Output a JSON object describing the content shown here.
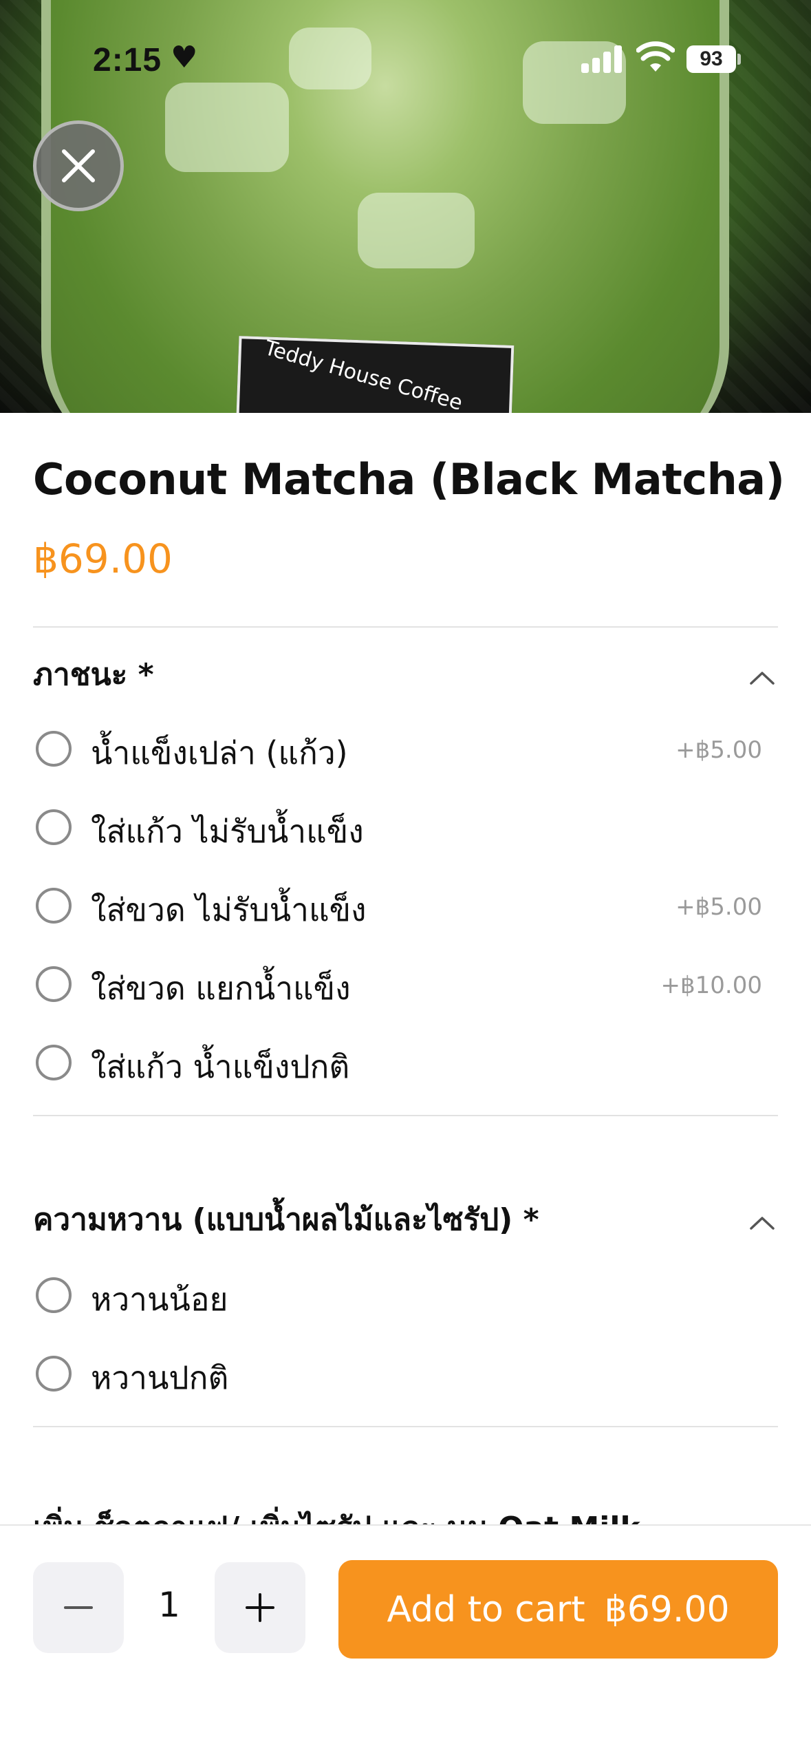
{
  "status_bar": {
    "time": "2:15",
    "battery": "93"
  },
  "hero": {
    "cup_text": "Teddy House Coffee"
  },
  "product": {
    "title": "Coconut Matcha (Black Matcha)",
    "price": "฿69.00"
  },
  "sections": [
    {
      "title": "ภาชนะ *",
      "options": [
        {
          "label": "น้ำแข็งเปล่า  (แก้ว)",
          "extra": "+฿5.00"
        },
        {
          "label": "ใส่แก้ว ไม่รับน้ำแข็ง",
          "extra": ""
        },
        {
          "label": "ใส่ขวด ไม่รับน้ำแข็ง",
          "extra": "+฿5.00"
        },
        {
          "label": "ใส่ขวด แยกน้ำแข็ง",
          "extra": "+฿10.00"
        },
        {
          "label": "ใส่แก้ว น้ำแข็งปกติ",
          "extra": ""
        }
      ]
    },
    {
      "title": "ความหวาน (แบบน้ำผลไม้และไซรัป) *",
      "options": [
        {
          "label": "หวานน้อย",
          "extra": ""
        },
        {
          "label": "หวานปกติ",
          "extra": ""
        }
      ]
    },
    {
      "title": "เพิ่ม ช็อตกาแฟ/ เพิ่มไซรัป และ นม Oat Milk"
    }
  ],
  "cart": {
    "quantity": "1",
    "add_label": "Add to cart",
    "add_price": "฿69.00"
  },
  "colors": {
    "accent": "#f7931e",
    "stepper_bg": "#f1f1f4"
  },
  "icons": [
    "close-icon",
    "chevron-up-icon",
    "minus-icon",
    "plus-icon",
    "heart-icon",
    "signal-icon",
    "wifi-icon",
    "battery-icon"
  ]
}
